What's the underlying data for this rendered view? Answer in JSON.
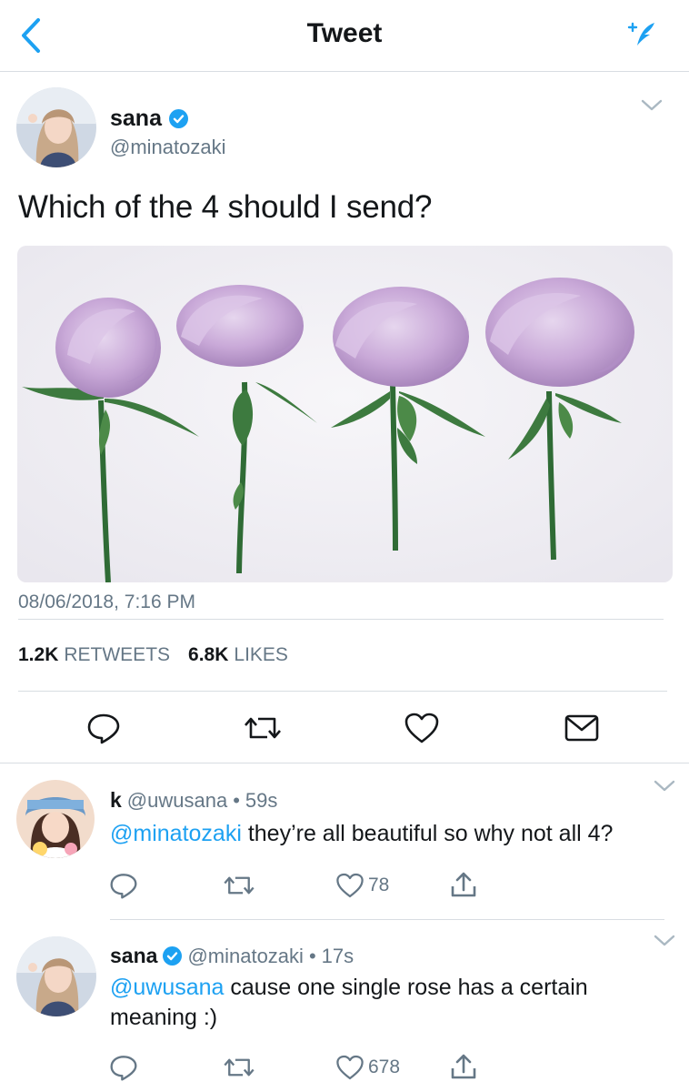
{
  "nav": {
    "title": "Tweet"
  },
  "tweet": {
    "author_name": "sana",
    "author_handle": "@minatozaki",
    "text": "Which of the 4 should I send?",
    "timestamp": "08/06/2018, 7:16 PM",
    "retweets_count": "1.2K",
    "retweets_label": "RETWEETS",
    "likes_count": "6.8K",
    "likes_label": "LIKES"
  },
  "replies": [
    {
      "name": "k",
      "handle": "@uwusana",
      "time": "59s",
      "mention": "@minatozaki",
      "text": "they’re all beautiful so why not all 4?",
      "likes": "78"
    },
    {
      "name": "sana",
      "handle": "@minatozaki",
      "time": "17s",
      "mention": "@uwusana",
      "text": "cause one single rose has a certain meaning :)",
      "likes": "678"
    }
  ],
  "separator": "•",
  "colors": {
    "accent": "#1da1f2",
    "secondary_text": "#657786",
    "icon": "#657786",
    "divider": "#d8dde2"
  }
}
